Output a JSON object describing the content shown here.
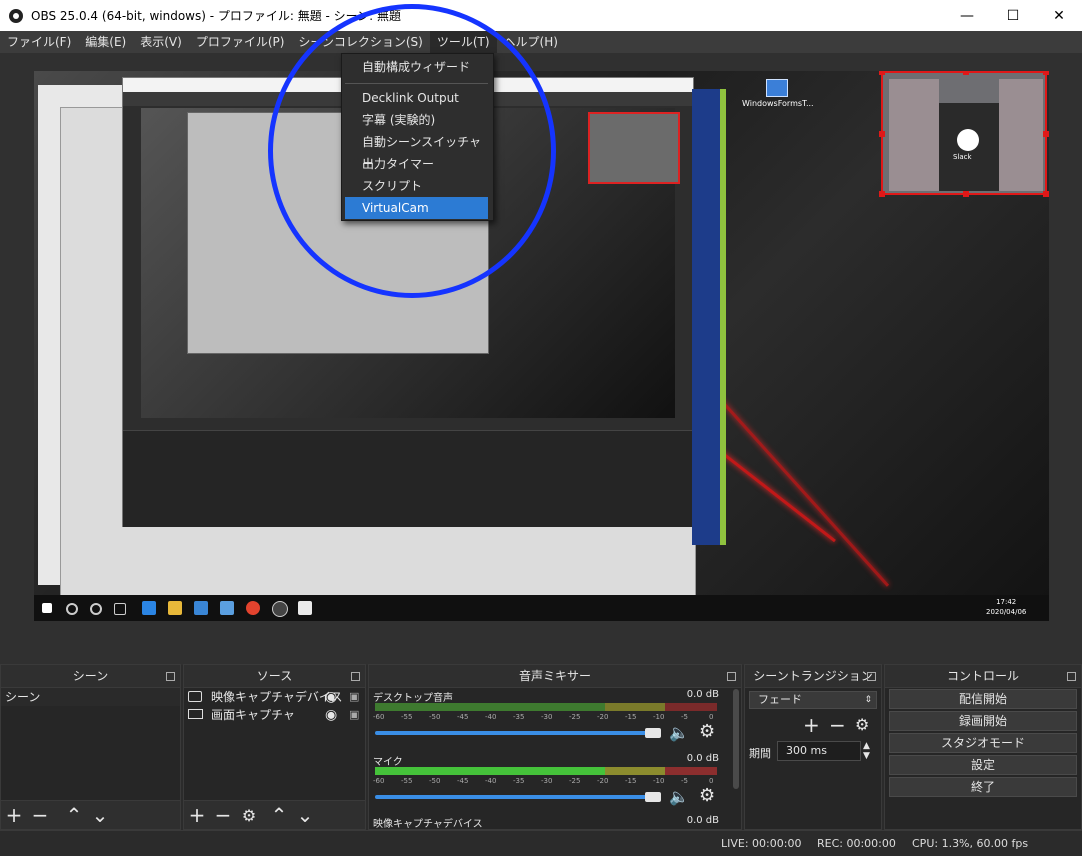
{
  "window": {
    "title": "OBS 25.0.4 (64-bit, windows) - プロファイル: 無題 - シーン: 無題"
  },
  "menu": [
    "ファイル(F)",
    "編集(E)",
    "表示(V)",
    "プロファイル(P)",
    "シーンコレクション(S)",
    "ツール(T)",
    "ヘルプ(H)"
  ],
  "tools_menu": {
    "items": [
      "自動構成ウィザード",
      "Decklink Output",
      "字幕 (実験的)",
      "自動シーンスイッチャー",
      "出力タイマー",
      "スクリプト",
      "VirtualCam"
    ],
    "selected": "VirtualCam"
  },
  "preview": {
    "slack_label": "Slack",
    "desktop_icon_label": "WindowsFormsT...",
    "clock_time": "17:42",
    "clock_date": "2020/04/06"
  },
  "docks": {
    "scenes": {
      "title": "シーン",
      "items": [
        "シーン"
      ]
    },
    "sources": {
      "title": "ソース",
      "items": [
        "映像キャプチャデバイス",
        "画面キャプチャ"
      ]
    },
    "mixer": {
      "title": "音声ミキサー",
      "channels": [
        {
          "name": "デスクトップ音声",
          "db": "0.0 dB"
        },
        {
          "name": "マイク",
          "db": "0.0 dB"
        },
        {
          "name": "映像キャプチャデバイス",
          "db": "0.0 dB"
        }
      ],
      "scale": [
        "-60",
        "-55",
        "-50",
        "-45",
        "-40",
        "-35",
        "-30",
        "-25",
        "-20",
        "-15",
        "-10",
        "-5",
        "0"
      ]
    },
    "transitions": {
      "title": "シーントランジション",
      "selected": "フェード",
      "duration_label": "期間",
      "duration_value": "300 ms"
    },
    "controls": {
      "title": "コントロール",
      "buttons": [
        "配信開始",
        "録画開始",
        "スタジオモード",
        "設定",
        "終了"
      ]
    }
  },
  "status": {
    "live": "LIVE: 00:00:00",
    "rec": "REC: 00:00:00",
    "cpu": "CPU: 1.3%, 60.00 fps"
  }
}
